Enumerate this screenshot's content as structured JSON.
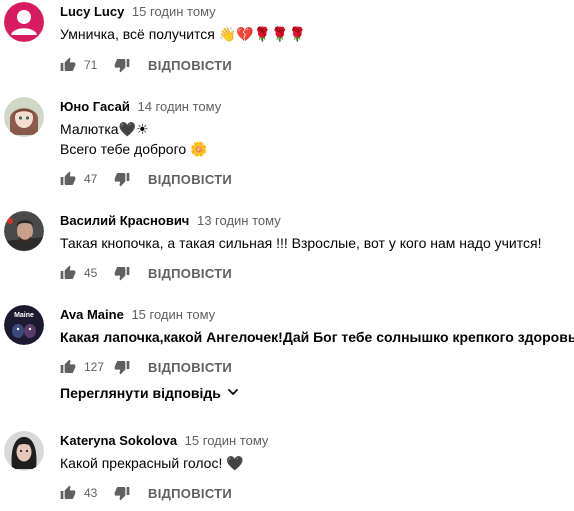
{
  "reply_label": "ВІДПОВІСТИ",
  "view_replies_label": "Переглянути відповідь",
  "colors": {
    "secondary_text": "#606060",
    "primary_text": "#030303",
    "avatar_pink": "#d81b60"
  },
  "comments": [
    {
      "author": "Lucy Lucy",
      "time": "15 годин тому",
      "lines": [
        "Умничка, всё получится 👋💔🌹🌹🌹"
      ],
      "likes": "71",
      "avatar_icon": "default-person-avatar-icon"
    },
    {
      "author": "Юно Гасай",
      "time": "14 годин тому",
      "lines": [
        "Малютка🖤☀",
        "Всего тебе доброго 🌼"
      ],
      "likes": "47",
      "avatar_icon": "anime-girl-avatar-icon"
    },
    {
      "author": "Василий Краснович",
      "time": "13 годин тому",
      "lines": [
        "Такая кнопочка, а такая сильная !!! Взрослые, вот у кого нам надо учится!"
      ],
      "likes": "45",
      "avatar_icon": "man-portrait-avatar-icon"
    },
    {
      "author": "Ava Maine",
      "time": "15 годин тому",
      "lines": [
        "Какая лапочка,какой Ангелочек!Дай Бог тебе солнышко крепкого здоровья)"
      ],
      "likes": "127",
      "avatar_icon": "maine-logo-avatar-icon",
      "avatar_text": "Maine"
    },
    {
      "author": "Kateryna Sokolova",
      "time": "15 годин тому",
      "lines": [
        "Какой прекрасный голос! 🖤"
      ],
      "likes": "43",
      "avatar_icon": "woman-portrait-avatar-icon"
    }
  ]
}
